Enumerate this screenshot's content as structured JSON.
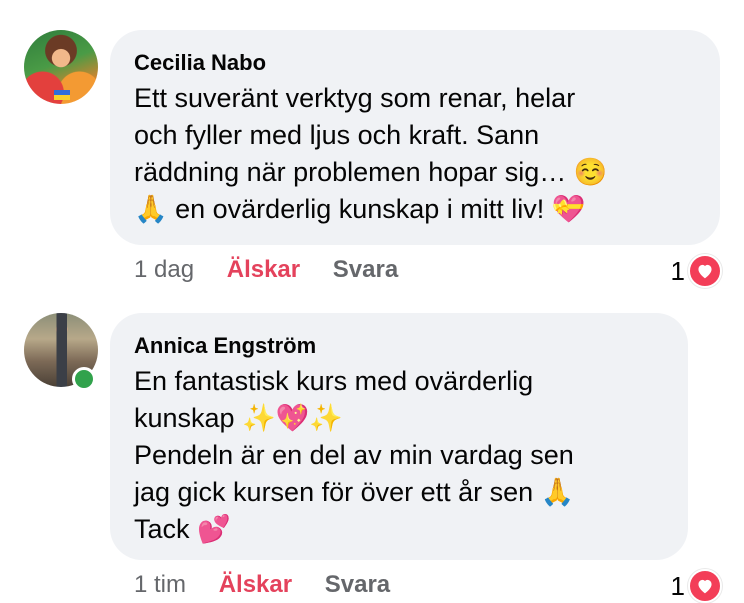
{
  "comments": [
    {
      "author": "Cecilia Nabo",
      "lines": [
        "Ett suveränt verktyg som renar, helar",
        "och fyller med ljus och kraft. Sann",
        "räddning när problemen hopar sig… ☺️",
        "🙏 en ovärderlig kunskap i mitt liv! 💝"
      ],
      "time": "1 dag",
      "love_label": "Älskar",
      "reply_label": "Svara",
      "reaction_count": "1",
      "reaction_icon": "heart-icon",
      "online": false
    },
    {
      "author": "Annica Engström",
      "lines": [
        "En fantastisk kurs med ovärderlig",
        "kunskap ✨💖✨",
        "Pendeln är en del av min vardag sen",
        "jag gick kursen för över ett år sen 🙏",
        "Tack 💕"
      ],
      "time": "1 tim",
      "love_label": "Älskar",
      "reply_label": "Svara",
      "reaction_count": "1",
      "reaction_icon": "heart-icon",
      "online": true
    }
  ],
  "colors": {
    "bubble": "#f0f2f5",
    "love": "#e4425c",
    "heart": "#f33e58",
    "online": "#31a24c",
    "meta": "#65676b"
  }
}
